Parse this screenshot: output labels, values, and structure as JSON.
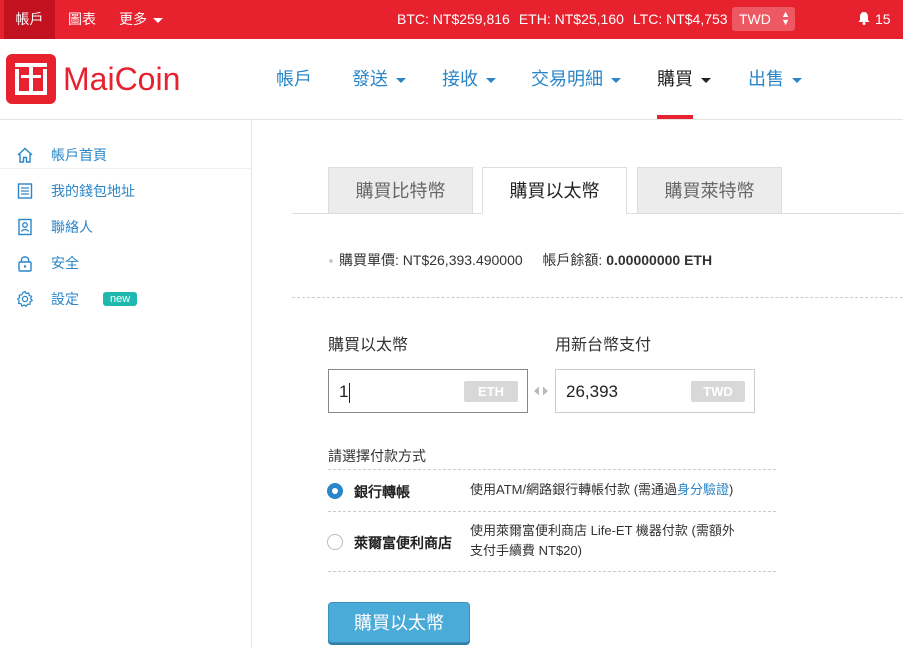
{
  "topbar": {
    "links": [
      "帳戶",
      "圖表",
      "更多"
    ],
    "prices": {
      "btc": "BTC: NT$259,816",
      "eth": "ETH: NT$25,160",
      "ltc": "LTC: NT$4,753"
    },
    "currency": "TWD",
    "notification_count": "15"
  },
  "header": {
    "logo_text": "MaiCoin",
    "nav": [
      "帳戶",
      "發送",
      "接收",
      "交易明細",
      "購買",
      "出售"
    ]
  },
  "sidebar": {
    "items": [
      {
        "label": "帳戶首頁",
        "icon": "home-icon"
      },
      {
        "label": "我的錢包地址",
        "icon": "list-icon"
      },
      {
        "label": "聯絡人",
        "icon": "contacts-icon"
      },
      {
        "label": "安全",
        "icon": "lock-icon"
      },
      {
        "label": "設定",
        "icon": "gear-icon",
        "badge": "new"
      }
    ]
  },
  "tabs": [
    "購買比特幣",
    "購買以太幣",
    "購買萊特幣"
  ],
  "info": {
    "price_label": "購買單價:",
    "price_value": "NT$26,393.490000",
    "balance_label": "帳戶餘額:",
    "balance_value": "0.00000000 ETH"
  },
  "form": {
    "eth_label": "購買以太幣",
    "twd_label": "用新台幣支付",
    "eth_value": "1",
    "eth_unit": "ETH",
    "twd_value": "26,393",
    "twd_unit": "TWD"
  },
  "payment": {
    "title": "請選擇付款方式",
    "options": [
      {
        "name": "銀行轉帳",
        "desc_prefix": "使用ATM/網路銀行轉帳付款 (需通過",
        "desc_link": "身分驗證",
        "desc_suffix": ")",
        "checked": true
      },
      {
        "name": "萊爾富便利商店",
        "desc_line1": "使用萊爾富便利商店 Life-ET 機器付款 (需額外",
        "desc_line2": "支付手續費 NT$20)",
        "checked": false
      }
    ]
  },
  "submit_label": "購買以太幣",
  "colors": {
    "brand_red": "#e8212f",
    "link_blue": "#2a86c8",
    "button_blue": "#4aaad8",
    "badge_teal": "#1fb8ae"
  }
}
